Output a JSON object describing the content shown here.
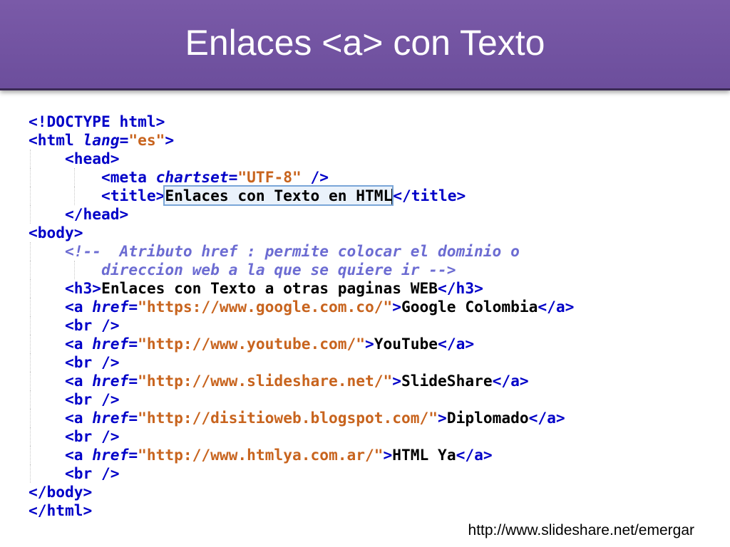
{
  "slide": {
    "title": "Enlaces <a> con Texto",
    "footer_url": "http://www.slideshare.net/emergar"
  },
  "code": {
    "doctype": "<!DOCTYPE html>",
    "lang_value": "\"es\"",
    "charset_value": "\"UTF-8\"",
    "page_title_text": "Enlaces con Texto en HTML",
    "comment_line1": "<!--  Atributo href : permite colocar el dominio o",
    "comment_line2": "direccion web a la que se quiere ir -->",
    "h3_text": "Enlaces con Texto a otras paginas WEB",
    "links": [
      {
        "href": "\"https://www.google.com.co/\"",
        "text": "Google Colombia"
      },
      {
        "href": "\"http://www.youtube.com/\"",
        "text": "YouTube"
      },
      {
        "href": "\"http://www.slideshare.net/\"",
        "text": "SlideShare"
      },
      {
        "href": "\"http://disitioweb.blogspot.com/\"",
        "text": "Diplomado"
      },
      {
        "href": "\"http://www.htmlya.com.ar/\"",
        "text": "HTML Ya"
      }
    ]
  }
}
